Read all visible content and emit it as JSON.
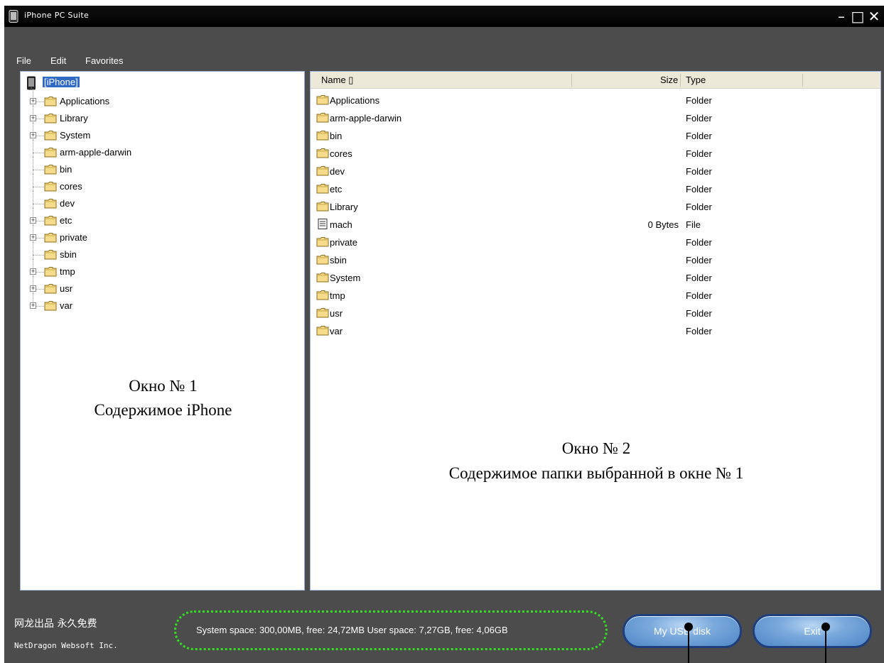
{
  "window": {
    "title": "iPhone PC Suite",
    "controls": {
      "minimize": "–",
      "maximize": "□",
      "close": "✕"
    }
  },
  "menu": [
    "File",
    "Edit",
    "Favorites"
  ],
  "tree": {
    "root": "[iPhone]",
    "items": [
      {
        "label": "Applications",
        "expandable": true
      },
      {
        "label": "Library",
        "expandable": true
      },
      {
        "label": "System",
        "expandable": true
      },
      {
        "label": "arm-apple-darwin",
        "expandable": false
      },
      {
        "label": "bin",
        "expandable": false
      },
      {
        "label": "cores",
        "expandable": false
      },
      {
        "label": "dev",
        "expandable": false
      },
      {
        "label": "etc",
        "expandable": true
      },
      {
        "label": "private",
        "expandable": true
      },
      {
        "label": "sbin",
        "expandable": false
      },
      {
        "label": "tmp",
        "expandable": true
      },
      {
        "label": "usr",
        "expandable": true
      },
      {
        "label": "var",
        "expandable": true
      }
    ],
    "caption_line1": "Окно № 1",
    "caption_line2": "Содержимое iPhone"
  },
  "list": {
    "columns": {
      "name": "Name",
      "size": "Size",
      "type": "Type"
    },
    "rows": [
      {
        "name": "Applications",
        "size": "",
        "type": "Folder",
        "icon": "folder-icon"
      },
      {
        "name": "arm-apple-darwin",
        "size": "",
        "type": "Folder",
        "icon": "folder-icon"
      },
      {
        "name": "bin",
        "size": "",
        "type": "Folder",
        "icon": "folder-icon"
      },
      {
        "name": "cores",
        "size": "",
        "type": "Folder",
        "icon": "folder-icon"
      },
      {
        "name": "dev",
        "size": "",
        "type": "Folder",
        "icon": "folder-icon"
      },
      {
        "name": "etc",
        "size": "",
        "type": "Folder",
        "icon": "folder-icon"
      },
      {
        "name": "Library",
        "size": "",
        "type": "Folder",
        "icon": "folder-icon"
      },
      {
        "name": "mach",
        "size": "0 Bytes",
        "type": "File",
        "icon": "file-icon"
      },
      {
        "name": "private",
        "size": "",
        "type": "Folder",
        "icon": "folder-icon"
      },
      {
        "name": "sbin",
        "size": "",
        "type": "Folder",
        "icon": "folder-icon"
      },
      {
        "name": "System",
        "size": "",
        "type": "Folder",
        "icon": "folder-icon"
      },
      {
        "name": "tmp",
        "size": "",
        "type": "Folder",
        "icon": "folder-icon"
      },
      {
        "name": "usr",
        "size": "",
        "type": "Folder",
        "icon": "folder-icon"
      },
      {
        "name": "var",
        "size": "",
        "type": "Folder",
        "icon": "folder-icon"
      }
    ],
    "caption_line1": "Окно № 2",
    "caption_line2": "Содержимое папки выбранной в окне № 1"
  },
  "footer": {
    "brand_cn": "网龙出品 永久免费",
    "brand_en": "NetDragon Websoft Inc.",
    "space_info": "System space: 300,00MB, free: 24,72MB  User space: 7,27GB, free: 4,06GB",
    "usb_button": "My USB disk",
    "exit_button": "Exit"
  },
  "colors": {
    "window_bg": "#4c4c4c",
    "selection": "#316ac5",
    "highlight_box": "#33dd22",
    "button": "#4f86c7"
  }
}
